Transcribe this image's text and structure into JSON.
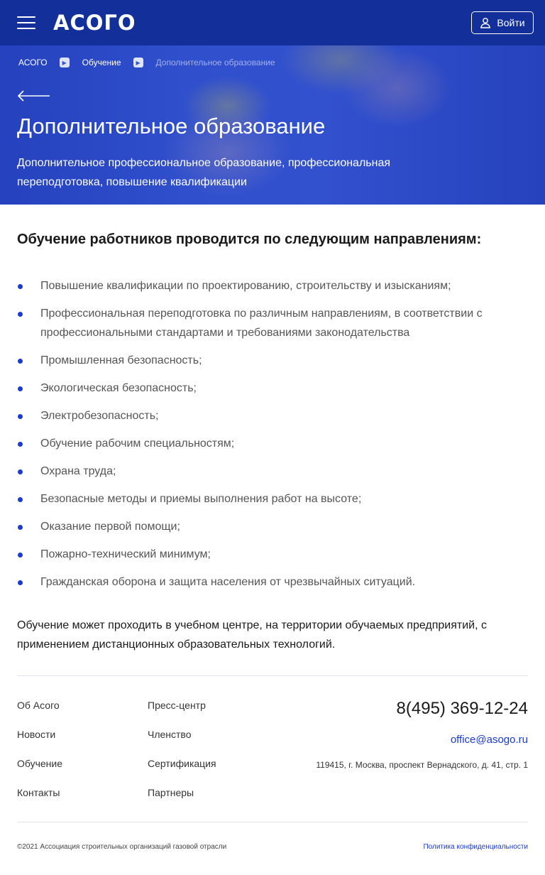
{
  "header": {
    "logo": "АСОГО",
    "login_label": "Войти"
  },
  "breadcrumb": {
    "items": [
      "АСОГО",
      "Обучение",
      "Дополнительное образование"
    ]
  },
  "hero": {
    "title": "Дополнительное образование",
    "subtitle": "Дополнительное профессиональное образование, профессиональная переподготовка, повышение квалификации"
  },
  "content": {
    "heading": "Обучение работников проводится по следующим направлениям:",
    "items": [
      "Повышение квалификации по проектированию, строительству и изысканиям;",
      "Профессиональная переподготовка по различным направлениям, в соответствии с профессиональными стандартами и требованиями законодательства",
      "Промышленная безопасность;",
      "Экологическая безопасность;",
      "Электробезопасность;",
      "Обучение рабочим специальностям;",
      "Охрана труда;",
      "Безопасные методы и приемы выполнения работ на высоте;",
      "Оказание первой помощи;",
      "Пожарно-технический минимум;",
      "Гражданская оборона и защита населения от чрезвычайных ситуаций."
    ],
    "outro": "Обучение может проходить в учебном центре, на территории обучаемых предприятий, с применением дистанционных образовательных технологий."
  },
  "footer": {
    "col1": [
      "Об Асого",
      "Новости",
      "Обучение",
      "Контакты"
    ],
    "col2": [
      "Пресс-центр",
      "Членство",
      "Сертификация",
      "Партнеры"
    ],
    "phone": "8(495) 369-12-24",
    "email": "office@asogo.ru",
    "address": "119415, г. Москва, проспект Вернадского, д. 41, стр. 1",
    "copyright": "©2021 Ассоциация строительных организаций газовой отрасли",
    "policy": "Политика конфиденциальности"
  },
  "colors": {
    "header_bg": "#13309a",
    "accent": "#1a3bd6"
  }
}
